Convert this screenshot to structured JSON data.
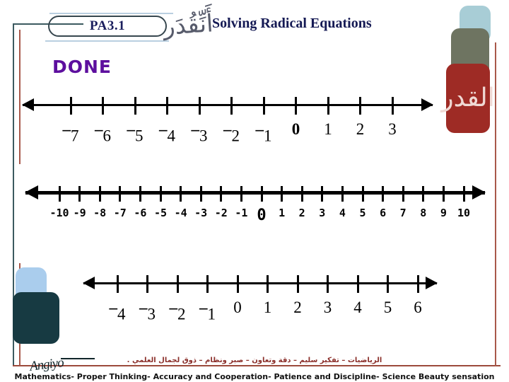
{
  "slide": {
    "badge_label": "PA3.1",
    "title": "Solving Radical Equations",
    "status_label": "DONE",
    "calligraphy_top": "أَنِّقُدَر",
    "calligraphy_red": "القدر",
    "signature": "Angiyo"
  },
  "colors": {
    "title": "#151a54",
    "badge_text": "#1b1f5e",
    "status": "#5d0f9e",
    "frame_teal": "#3c5a60",
    "frame_rust": "#a8584a",
    "deco_blue": "#a8cdd6",
    "deco_olive": "#6e7461",
    "deco_red": "#9e2b25",
    "deco_blue_bottom": "#aacded",
    "deco_teal_bottom": "#173a42",
    "footer_arabic": "#8b2f2a",
    "footer_english": "#111111",
    "axis": "#000000"
  },
  "number_lines": [
    {
      "name": "number-line-1",
      "min": -7,
      "max": 3,
      "minus_style": "raised-bar",
      "left_arrow": true,
      "right_arrow": true,
      "bold_zero": true,
      "labels": [
        "7",
        "6",
        "5",
        "4",
        "3",
        "2",
        "1",
        "0",
        "1",
        "2",
        "3"
      ],
      "values": [
        -7,
        -6,
        -5,
        -4,
        -3,
        -2,
        -1,
        0,
        1,
        2,
        3
      ]
    },
    {
      "name": "number-line-2",
      "min": -10,
      "max": 10,
      "minus_style": "hyphen",
      "left_arrow": true,
      "right_arrow": true,
      "bold_zero": true,
      "labels": [
        "-10",
        "-9",
        "-8",
        "-7",
        "-6",
        "-5",
        "-4",
        "-3",
        "-2",
        "-1",
        "0",
        "1",
        "2",
        "3",
        "4",
        "5",
        "6",
        "7",
        "8",
        "9",
        "10"
      ],
      "values": [
        -10,
        -9,
        -8,
        -7,
        -6,
        -5,
        -4,
        -3,
        -2,
        -1,
        0,
        1,
        2,
        3,
        4,
        5,
        6,
        7,
        8,
        9,
        10
      ]
    },
    {
      "name": "number-line-3",
      "min": -4,
      "max": 6,
      "minus_style": "raised-bar",
      "left_arrow": true,
      "right_arrow": true,
      "bold_zero": false,
      "labels": [
        "4",
        "3",
        "2",
        "1",
        "0",
        "1",
        "2",
        "3",
        "4",
        "5",
        "6"
      ],
      "values": [
        -4,
        -3,
        -2,
        -1,
        0,
        1,
        2,
        3,
        4,
        5,
        6
      ]
    }
  ],
  "footer": {
    "arabic": "الرياضيات – تفكير سليم – دقة وتعاون – صبر ونظام – ذوق لجمال العلمي .",
    "english": "Mathematics- Proper Thinking- Accuracy and Cooperation- Patience and Discipline- Science Beauty sensation"
  }
}
